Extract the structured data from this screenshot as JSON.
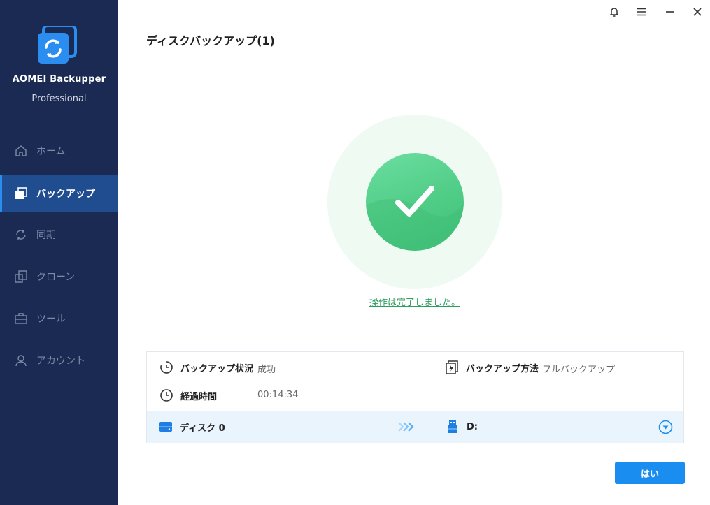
{
  "app": {
    "name": "AOMEI Backupper",
    "edition": "Professional"
  },
  "sidebar": {
    "items": [
      {
        "label": "ホーム",
        "icon": "home-icon",
        "active": false
      },
      {
        "label": "バックアップ",
        "icon": "backup-icon",
        "active": true
      },
      {
        "label": "同期",
        "icon": "sync-icon",
        "active": false
      },
      {
        "label": "クローン",
        "icon": "clone-icon",
        "active": false
      },
      {
        "label": "ツール",
        "icon": "tools-icon",
        "active": false
      },
      {
        "label": "アカウント",
        "icon": "account-icon",
        "active": false
      }
    ]
  },
  "window_controls": [
    "bell-icon",
    "menu-icon",
    "minimize-icon",
    "close-icon"
  ],
  "page": {
    "title": "ディスクバックアップ(1)",
    "status_message": "操作は完了しました。"
  },
  "details": {
    "status_label": "バックアップ状況",
    "status_value": "成功",
    "method_label": "バックアップ方法",
    "method_value": "フルバックアップ",
    "elapsed_label": "経過時間",
    "elapsed_value": "00:14:34",
    "source": "ディスク 0",
    "destination": "D:"
  },
  "footer": {
    "ok_label": "はい"
  },
  "colors": {
    "sidebar_bg": "#1b2a52",
    "sidebar_active": "#1f4d8f",
    "success_green": "#4fcc86",
    "accent_blue": "#1a8ef0"
  }
}
